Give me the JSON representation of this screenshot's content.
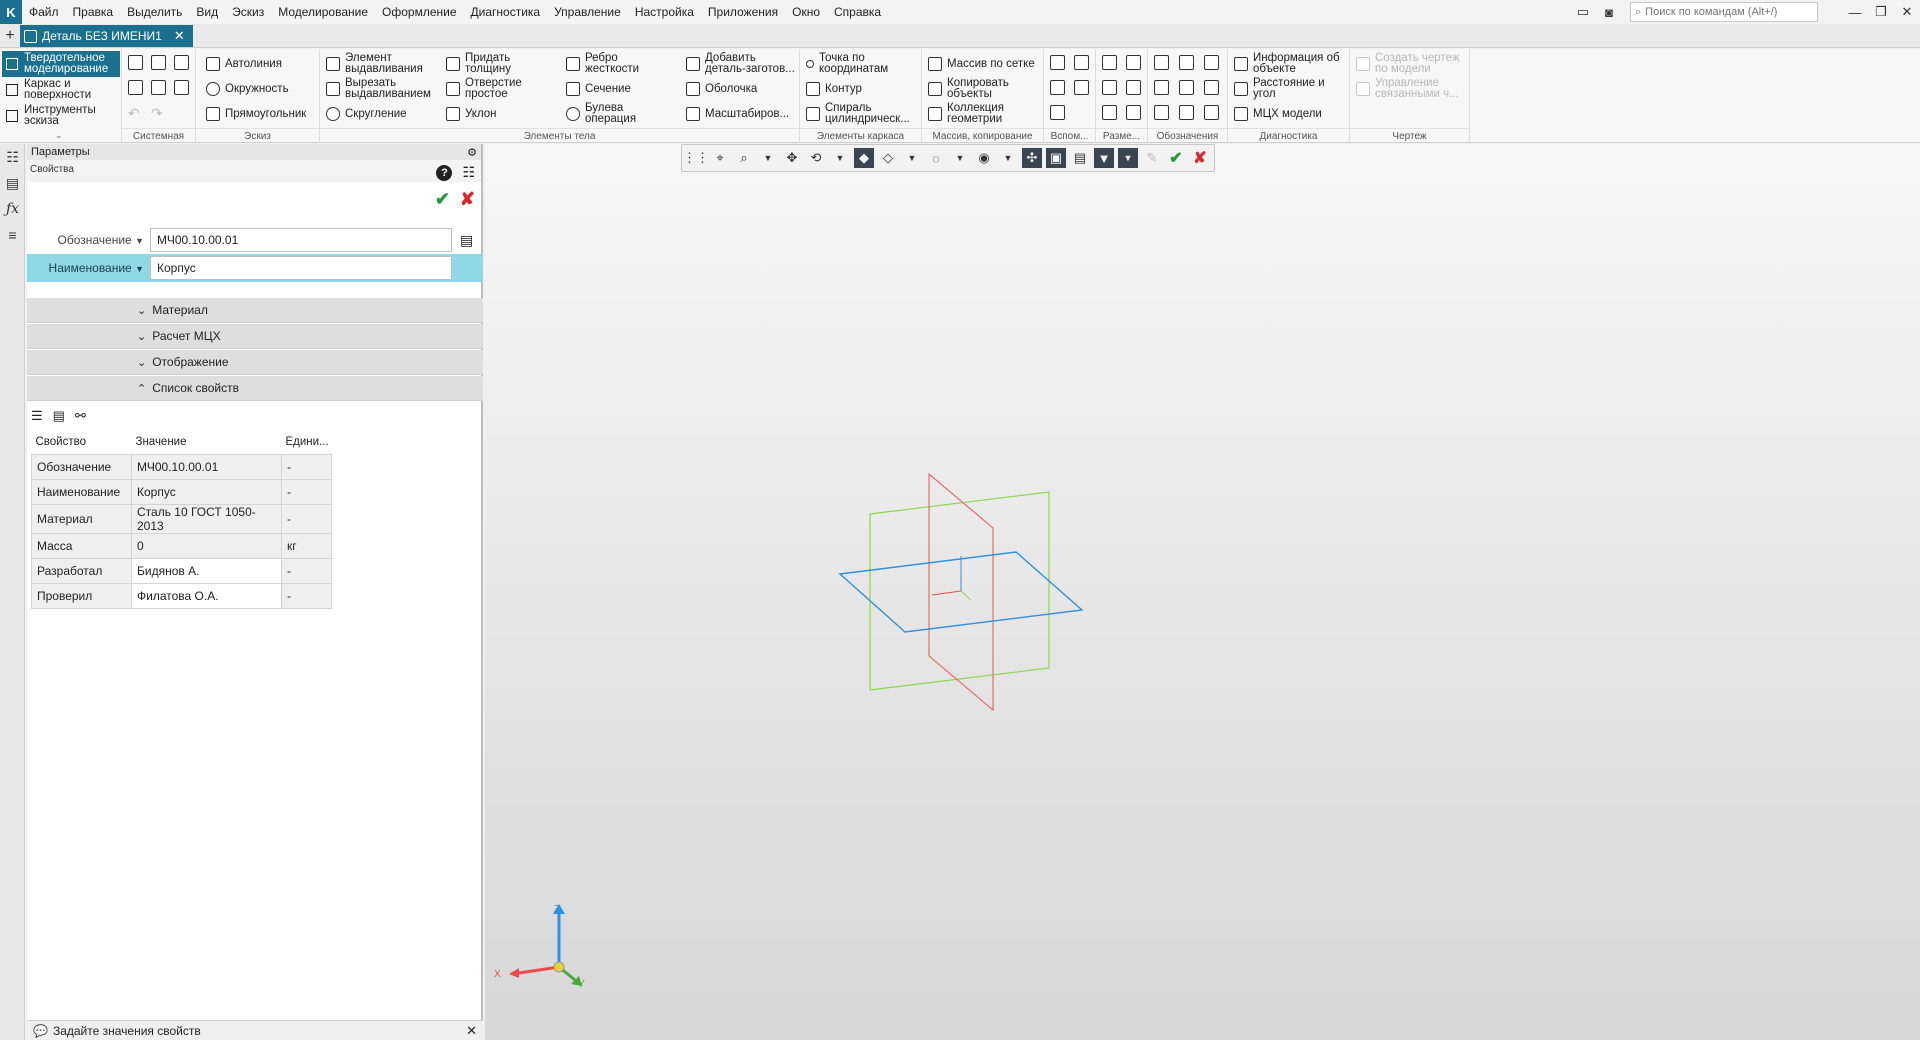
{
  "menu": {
    "items": [
      "Файл",
      "Правка",
      "Выделить",
      "Вид",
      "Эскиз",
      "Моделирование",
      "Оформление",
      "Диагностика",
      "Управление",
      "Настройка",
      "Приложения",
      "Окно",
      "Справка"
    ],
    "search_placeholder": "Поиск по командам (Alt+/)"
  },
  "tab": {
    "title": "Деталь БЕЗ ИМЕНИ1"
  },
  "ribbon": {
    "modes": [
      "Твердотельное моделирование",
      "Каркас и поверхности",
      "Инструменты эскиза"
    ],
    "groups": {
      "system": "Системная",
      "sketch": "Эскиз",
      "body": "Элементы тела",
      "frame": "Элементы каркаса",
      "array": "Массив, копирование",
      "aux": "Вспом...",
      "dims": "Разме...",
      "notes": "Обозначения",
      "diag": "Диагностика",
      "drawing": "Чертеж"
    },
    "sketch_buttons": [
      "Автолиния",
      "Окружность",
      "Прямоугольник"
    ],
    "body_buttons": [
      "Элемент выдавливания",
      "Вырезать выдавливанием",
      "Скругление",
      "Придать толщину",
      "Отверстие простое",
      "Уклон",
      "Ребро жесткости",
      "Сечение",
      "Булева операция",
      "Добавить деталь-заготов...",
      "Оболочка",
      "Масштабиров..."
    ],
    "frame_buttons": [
      "Точка по координатам",
      "Контур",
      "Спираль цилиндрическ..."
    ],
    "array_buttons": [
      "Массив по сетке",
      "Копировать объекты",
      "Коллекция геометрии"
    ],
    "diag_buttons": [
      "Информация об объекте",
      "Расстояние и угол",
      "МЦХ модели"
    ],
    "drawing_buttons": [
      "Создать чертеж по модели",
      "Управление связанными ч..."
    ]
  },
  "panel": {
    "title": "Параметры",
    "subtitle": "Свойства",
    "designation_label": "Обозначение",
    "designation_value": "МЧ00.10.00.01",
    "name_label": "Наименование",
    "name_value": "Корпус",
    "sections": [
      "Материал",
      "Расчет МЦХ",
      "Отображение",
      "Список свойств"
    ],
    "table": {
      "headers": [
        "Свойство",
        "Значение",
        "Едини..."
      ],
      "rows": [
        [
          "Обозначение",
          "МЧ00.10.00.01",
          "-"
        ],
        [
          "Наименование",
          "Корпус",
          "-"
        ],
        [
          "Материал",
          "Сталь 10  ГОСТ 1050-2013",
          "-"
        ],
        [
          "Масса",
          "0",
          "кг"
        ],
        [
          "Разработал",
          "Бидянов А.",
          "-"
        ],
        [
          "Проверил",
          "Филатова О.А.",
          "-"
        ]
      ]
    },
    "status": "Задайте значения свойств"
  },
  "axes": {
    "x": "X",
    "y": "Y",
    "z": "Z"
  },
  "colors": {
    "accent": "#1b6f8f",
    "highlight": "#8fd8e6",
    "ok": "#1f9a3a",
    "cancel": "#d62828"
  }
}
